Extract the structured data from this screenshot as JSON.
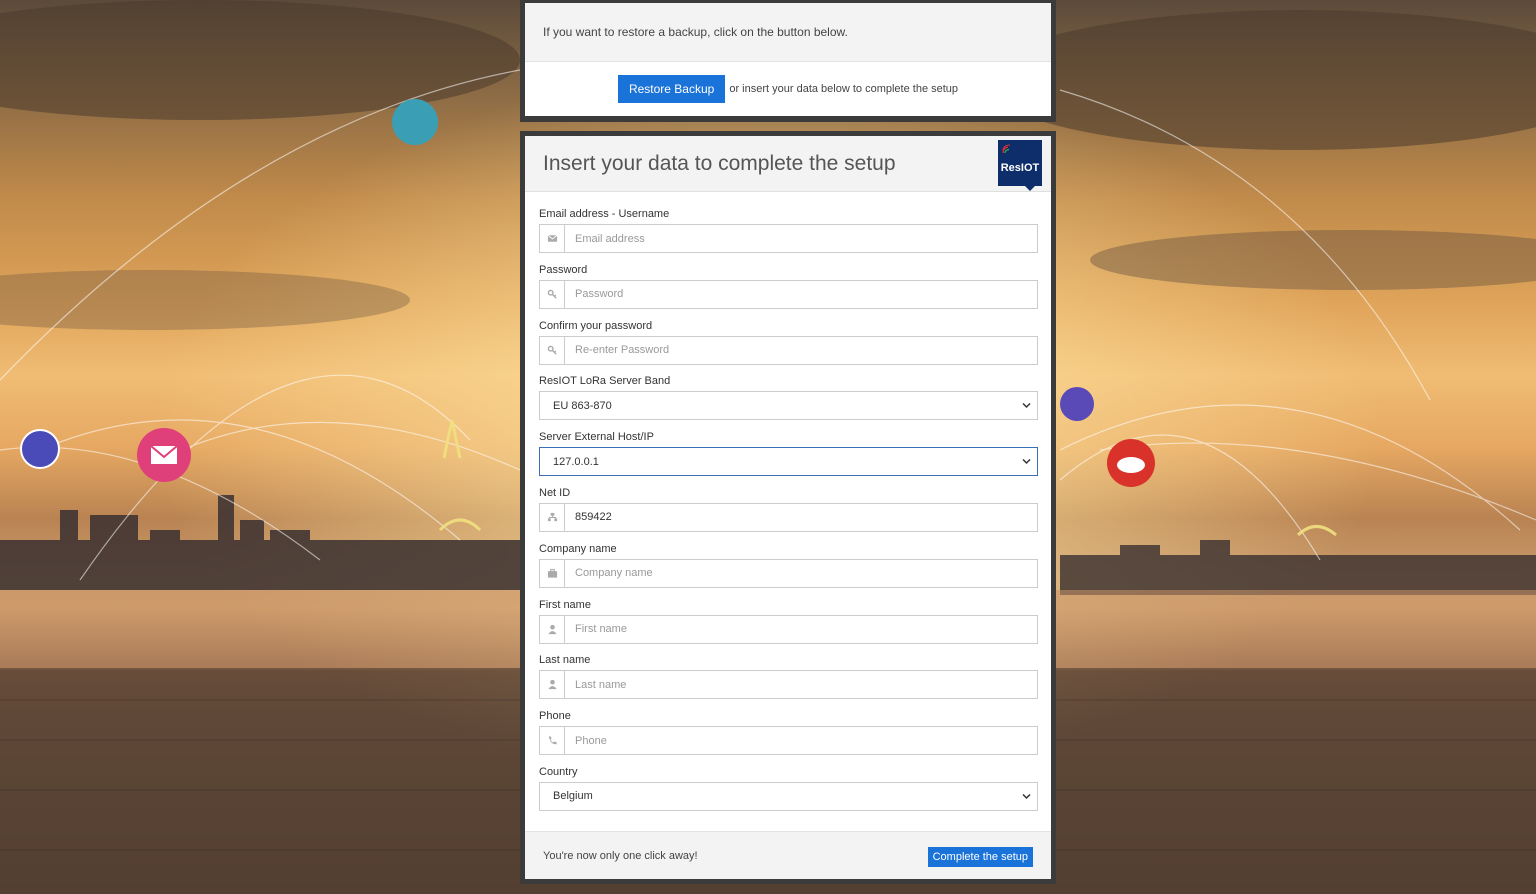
{
  "restore": {
    "message": "If you want to restore a backup, click on the button below.",
    "button_label": "Restore Backup",
    "alt_text": "or insert your data below to complete the setup"
  },
  "setup": {
    "title": "Insert your data to complete the setup",
    "logo_text": "ResIOT",
    "fields": {
      "email": {
        "label": "Email address - Username",
        "placeholder": "Email address",
        "value": "",
        "icon": "envelope-icon"
      },
      "password": {
        "label": "Password",
        "placeholder": "Password",
        "value": "",
        "icon": "key-icon"
      },
      "confirm_password": {
        "label": "Confirm your password",
        "placeholder": "Re-enter Password",
        "value": "",
        "icon": "key-icon"
      },
      "lora_band": {
        "label": "ResIOT LoRa Server Band",
        "selected": "EU 863-870"
      },
      "external_host": {
        "label": "Server External Host/IP",
        "selected": "127.0.0.1"
      },
      "net_id": {
        "label": "Net ID",
        "placeholder": "",
        "value": "859422",
        "icon": "sitemap-icon"
      },
      "company": {
        "label": "Company name",
        "placeholder": "Company name",
        "value": "",
        "icon": "briefcase-icon"
      },
      "first_name": {
        "label": "First name",
        "placeholder": "First name",
        "value": "",
        "icon": "user-icon"
      },
      "last_name": {
        "label": "Last name",
        "placeholder": "Last name",
        "value": "",
        "icon": "user-icon"
      },
      "phone": {
        "label": "Phone",
        "placeholder": "Phone",
        "value": "",
        "icon": "phone-icon"
      },
      "country": {
        "label": "Country",
        "selected": "Belgium"
      }
    },
    "footer_text": "You're now only one click away!",
    "complete_button": "Complete the setup"
  },
  "colors": {
    "primary_button": "#1a73d9",
    "panel_border": "#3b3b3b",
    "logo_bg": "#0d2d6b"
  }
}
